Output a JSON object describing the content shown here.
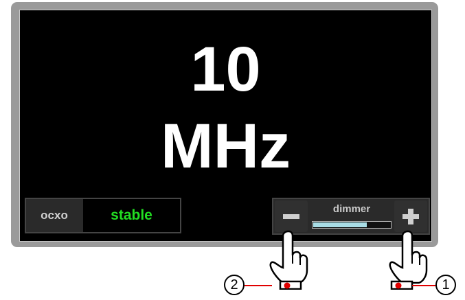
{
  "display": {
    "frequency_value": "10",
    "frequency_unit": "MHz"
  },
  "ocxo": {
    "label": "ocxo",
    "status": "stable",
    "status_color": "#22dd22"
  },
  "dimmer": {
    "label": "dimmer",
    "level": 0.7,
    "fill_color": "#a9dde6",
    "minus_icon": "minus-icon",
    "plus_icon": "plus-icon"
  },
  "callouts": {
    "plus_tap": "1",
    "minus_tap": "2",
    "marker_color": "#e00000"
  }
}
